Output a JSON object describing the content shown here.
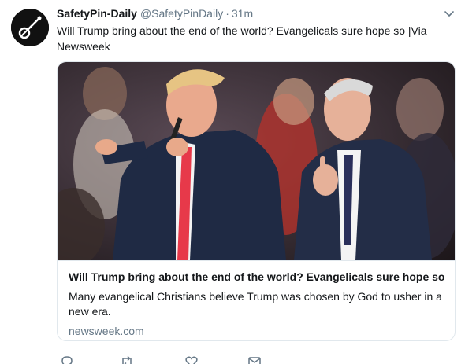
{
  "tweet": {
    "author_name": "SafetyPin-Daily",
    "author_handle": "@SafetyPinDaily",
    "separator": "·",
    "time": "31m",
    "text": "Will Trump bring about the end of the world? Evangelicals sure hope so |Via Newsweek"
  },
  "card": {
    "title": "Will Trump bring about the end of the world? Evangelicals sure hope so",
    "description": "Many evangelical Christians believe Trump was chosen by God to usher in a new era.",
    "domain": "newsweek.com"
  },
  "icons": {
    "avatar": "safety-pin-logo",
    "menu": "chevron-down-icon",
    "actions": [
      "reply-icon",
      "retweet-icon",
      "like-icon",
      "direct-message-icon"
    ]
  },
  "colors": {
    "text": "#14171a",
    "secondary": "#657786",
    "border": "#e1e8ed"
  }
}
